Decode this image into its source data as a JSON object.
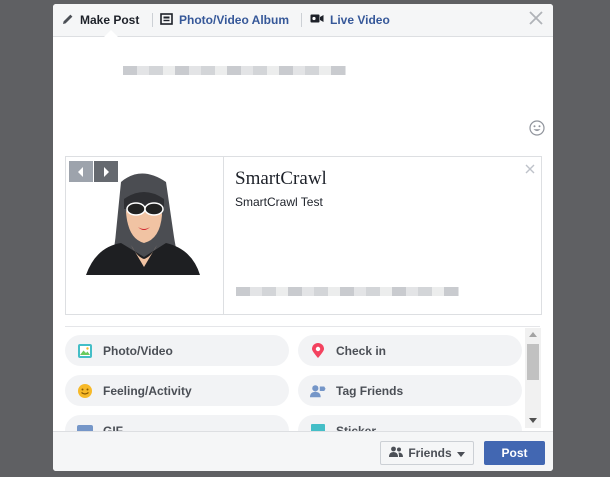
{
  "tabs": {
    "make_post": "Make Post",
    "album": "Photo/Video Album",
    "live": "Live Video"
  },
  "preview": {
    "title": "SmartCrawl",
    "description": "SmartCrawl Test"
  },
  "actions": [
    {
      "label": "Photo/Video",
      "icon": "photo-icon"
    },
    {
      "label": "Check in",
      "icon": "location-pin-icon"
    },
    {
      "label": "Feeling/Activity",
      "icon": "smiley-icon"
    },
    {
      "label": "Tag Friends",
      "icon": "tag-friends-icon"
    },
    {
      "label": "GIF",
      "icon": "gif-icon"
    },
    {
      "label": "Sticker",
      "icon": "sticker-icon"
    }
  ],
  "footer": {
    "audience": "Friends",
    "post": "Post"
  },
  "colors": {
    "brand_blue": "#4267b2",
    "link_blue": "#365899",
    "overlay": "#5f6063"
  }
}
